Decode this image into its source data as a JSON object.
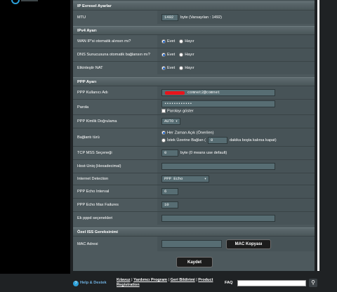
{
  "sections": {
    "ip_extra": {
      "title": "IP Evresel Ayarlar",
      "mtu_label": "MTU",
      "mtu_value": "1492",
      "mtu_hint": "byte (Varsayılan : 1492)"
    },
    "ipv4": {
      "title": "IPv4 Ayarı",
      "wan_ip_label": "WAN IP'si otomatik alınsın mı?",
      "dns_label": "DNS Sunucusuna otomatik bağlansın mı?",
      "nat_label": "Etkinleştir NAT",
      "yes": "Evet",
      "no": "Hayır"
    },
    "ppp": {
      "title": "PPP Ayarı",
      "username_label": "PPP Kullanıcı Adı",
      "username_value": "comnet2@comnet",
      "password_label": "Parola",
      "password_value": "••••••••••••",
      "show_password": "Parolayı göster",
      "auth_label": "PPP Kimlik Doğrulama",
      "auth_value": "AUTO",
      "conn_type_label": "Bağlantı türü",
      "always_on": "Her Zaman Açık (Önerilen)",
      "on_demand_prefix": "İstek Üzerine Bağlan (",
      "idle_value": "0",
      "idle_suffix": "dakika boşta kalırsa kapat)",
      "mss_label": "TCP MSS Seçeneği",
      "mss_value": "0",
      "mss_hint": "byte (0 means use default)",
      "hostuniq_label": "Host-Uniq (Hexadecimal)",
      "hostuniq_value": "",
      "detection_label": "Internet Detection",
      "detection_value": "PPP Echo",
      "echo_interval_label": "PPP Echo Interval",
      "echo_interval_value": "6",
      "echo_max_label": "PPP Echo Max Failures",
      "echo_max_value": "10",
      "extra_label": "Ek pppd seçenekleri",
      "extra_value": ""
    },
    "isp": {
      "title": "Özel ISS Gereksinimi",
      "mac_label": "MAC Adresi",
      "mac_value": "",
      "mac_button": "MAC Kopyası"
    }
  },
  "apply_button": "Kaydet",
  "footer": {
    "help": "Help & Destek",
    "manual": "Kılavuz",
    "utility": "Yardımcı Program",
    "feedback": "Geri Bildirimi",
    "product": "Product",
    "registration": "Registration",
    "faq": "FAQ",
    "search_value": ""
  },
  "colors": {
    "panel": "#4d595d",
    "accent_blue": "#2b9fd8",
    "redaction": "#e8141c"
  }
}
